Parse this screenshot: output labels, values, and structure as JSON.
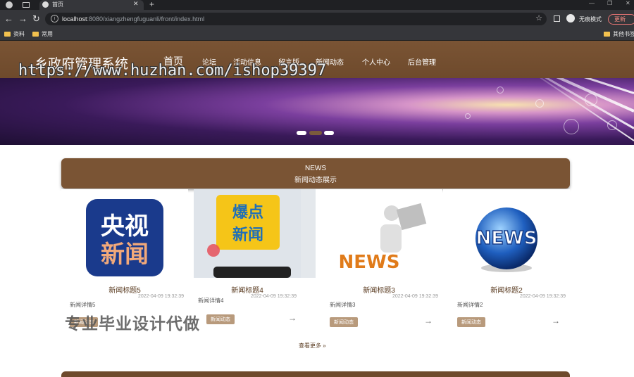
{
  "browser": {
    "tab_title": "首页",
    "url_host": "localhost",
    "url_rest": ":8080/xiangzhengfuguanli/front/index.html",
    "incognito_label": "无痕模式",
    "update_label": "更新",
    "bookmarks": [
      {
        "label": "资料"
      },
      {
        "label": "常用"
      }
    ],
    "other_bookmarks": "其他书签"
  },
  "site": {
    "title": "乡政府管理系统",
    "nav": [
      {
        "label": "首页"
      },
      {
        "label": "论坛"
      },
      {
        "label": "活动信息"
      },
      {
        "label": "留言版"
      },
      {
        "label": "新闻动态"
      },
      {
        "label": "个人中心"
      },
      {
        "label": "后台管理"
      }
    ],
    "watermark": "https://www.huzhan.com/ishop39397"
  },
  "banner": {
    "slides": 3,
    "active_slide": 2
  },
  "news": {
    "heading_en": "NEWS",
    "heading_cn": "新闻动态展示",
    "cards": [
      {
        "title": "新闻标题5",
        "date": "2022-04-09 19:32:39",
        "desc": "新闻详情5",
        "tag": "新闻动态",
        "image": "cctv-news-logo"
      },
      {
        "title": "新闻标题4",
        "date": "2022-04-09 19:32:39",
        "desc": "新闻详情4",
        "tag": "新闻动态",
        "image": "breaking-news-graphic"
      },
      {
        "title": "新闻标题3",
        "date": "2022-04-09 19:32:39",
        "desc": "新闻详情3",
        "tag": "新闻动态",
        "image": "reading-figure-news"
      },
      {
        "title": "新闻标题2",
        "date": "2022-04-09 19:32:39",
        "desc": "新闻详情2",
        "tag": "新闻动态",
        "image": "news-globe"
      }
    ],
    "see_more": "查看更多",
    "arrow": "→",
    "overlay_text": "专业毕业设计代做"
  },
  "colors": {
    "brand_brown": "#7a5434",
    "tag_bg": "#b89a7c"
  }
}
